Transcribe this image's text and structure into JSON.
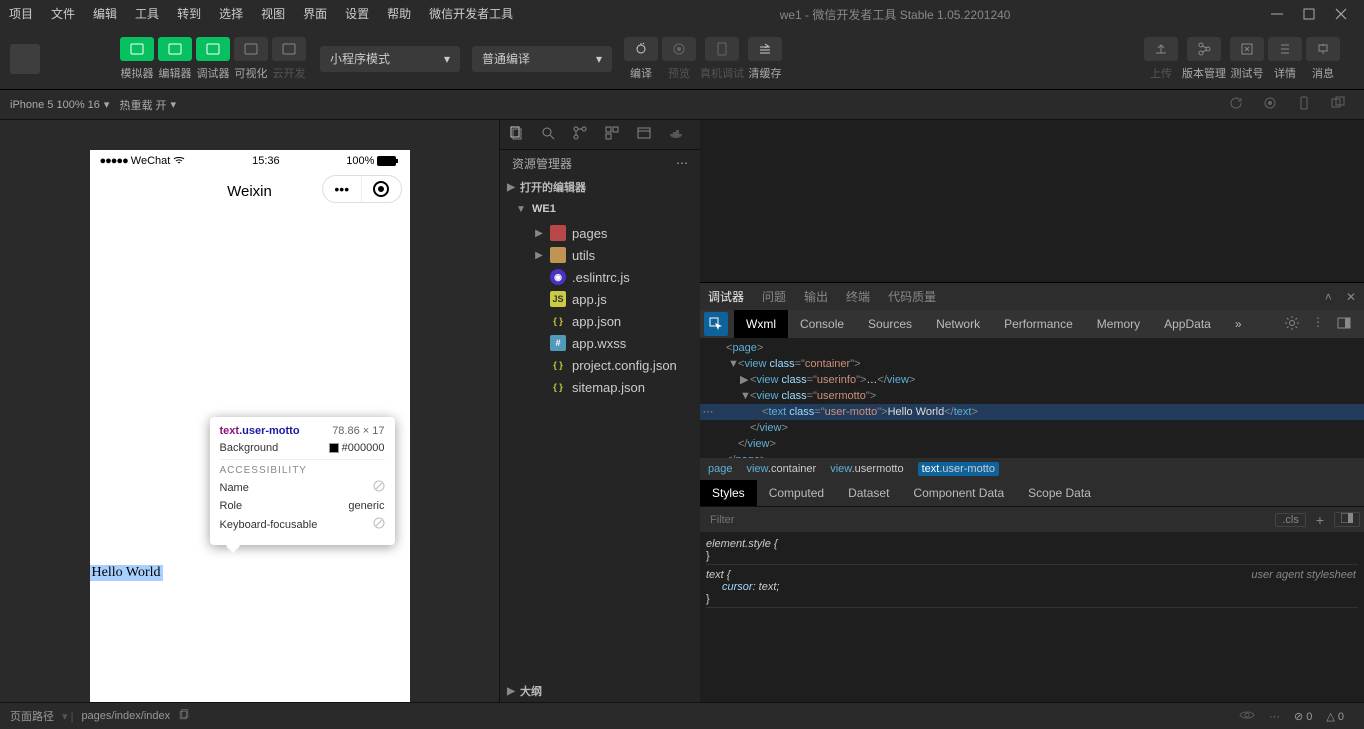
{
  "titlebar": {
    "menus": [
      "项目",
      "文件",
      "编辑",
      "工具",
      "转到",
      "选择",
      "视图",
      "界面",
      "设置",
      "帮助",
      "微信开发者工具"
    ],
    "title": "we1 - 微信开发者工具 Stable 1.05.2201240"
  },
  "toolbar": {
    "items": [
      {
        "label": "模拟器",
        "green": true
      },
      {
        "label": "编辑器",
        "green": true
      },
      {
        "label": "调试器",
        "green": true
      },
      {
        "label": "可视化",
        "green": false
      },
      {
        "label": "云开发",
        "green": false,
        "dim": true
      }
    ],
    "mode_dd": "小程序模式",
    "compile_dd": "普通编译",
    "mid_items": [
      {
        "label": "编译"
      },
      {
        "label": "预览",
        "dim": true
      },
      {
        "label": "真机调试",
        "dim": true
      },
      {
        "label": "清缓存"
      }
    ],
    "right_items": [
      "上传",
      "版本管理",
      "测试号",
      "详情",
      "消息"
    ]
  },
  "simbar": {
    "device": "iPhone 5 100% 16",
    "hot": "热重载 开"
  },
  "phone": {
    "carrier": "WeChat",
    "time": "15:36",
    "battery": "100%",
    "nav_title": "Weixin",
    "hello": "Hello World"
  },
  "inspect": {
    "sel_tag": "text",
    "sel_cls": ".user-motto",
    "dims": "78.86 × 17",
    "bg_label": "Background",
    "bg_val": "#000000",
    "acc": "ACCESSIBILITY",
    "rows": [
      {
        "k": "Name",
        "v": ""
      },
      {
        "k": "Role",
        "v": "generic"
      },
      {
        "k": "Keyboard-focusable",
        "v": ""
      }
    ]
  },
  "explorer": {
    "title": "资源管理器",
    "open_editors": "打开的编辑器",
    "project": "WE1",
    "tree": [
      {
        "name": "pages",
        "ico": "ico-folder-red",
        "folder": true
      },
      {
        "name": "utils",
        "ico": "ico-folder",
        "folder": true
      },
      {
        "name": ".eslintrc.js",
        "ico": "ico-eslint"
      },
      {
        "name": "app.js",
        "ico": "ico-js"
      },
      {
        "name": "app.json",
        "ico": "ico-json"
      },
      {
        "name": "app.wxss",
        "ico": "ico-css"
      },
      {
        "name": "project.config.json",
        "ico": "ico-json"
      },
      {
        "name": "sitemap.json",
        "ico": "ico-json"
      }
    ],
    "outline": "大纲"
  },
  "devtools": {
    "outer_tabs": [
      "调试器",
      "问题",
      "输出",
      "终端",
      "代码质量"
    ],
    "inner_tabs": [
      "Wxml",
      "Console",
      "Sources",
      "Network",
      "Performance",
      "Memory",
      "AppData"
    ],
    "crumbs": [
      {
        "t": "page",
        "c": ""
      },
      {
        "t": "view",
        "c": ".container"
      },
      {
        "t": "view",
        "c": ".usermotto"
      },
      {
        "t": "text",
        "c": ".user-motto",
        "sel": true
      }
    ],
    "style_tabs": [
      "Styles",
      "Computed",
      "Dataset",
      "Component Data",
      "Scope Data"
    ],
    "filter_ph": "Filter",
    "cls_btn": ".cls",
    "el_style": "element.style {",
    "text_rule": "text {",
    "cursor_prop": "cursor",
    "cursor_val": ": text;",
    "ua_sheet": "user agent stylesheet"
  },
  "wxml": [
    {
      "l": 0,
      "ar": "",
      "h": "<span class='wx-punc'>&lt;</span><span class='wx-tag'>page</span><span class='wx-punc'>&gt;</span>"
    },
    {
      "l": 1,
      "ar": "▼",
      "h": "<span class='wx-punc'>&lt;</span><span class='wx-tag'>view</span> <span class='wx-attr'>class</span><span class='wx-punc'>=\"</span><span class='wx-str'>container</span><span class='wx-punc'>\"&gt;</span>"
    },
    {
      "l": 2,
      "ar": "▶",
      "h": "<span class='wx-punc'>&lt;</span><span class='wx-tag'>view</span> <span class='wx-attr'>class</span><span class='wx-punc'>=\"</span><span class='wx-str'>userinfo</span><span class='wx-punc'>\"&gt;</span><span class='wx-txt'>…</span><span class='wx-punc'>&lt;/</span><span class='wx-tag'>view</span><span class='wx-punc'>&gt;</span>"
    },
    {
      "l": 2,
      "ar": "▼",
      "h": "<span class='wx-punc'>&lt;</span><span class='wx-tag'>view</span> <span class='wx-attr'>class</span><span class='wx-punc'>=\"</span><span class='wx-str'>usermotto</span><span class='wx-punc'>\"&gt;</span>"
    },
    {
      "l": 3,
      "ar": "",
      "hl": true,
      "h": "<span class='wx-punc'>&lt;</span><span class='wx-tag'>text</span> <span class='wx-attr'>class</span><span class='wx-punc'>=\"</span><span class='wx-str'>user-motto</span><span class='wx-punc'>\"&gt;</span><span class='wx-txt'>Hello World</span><span class='wx-punc'>&lt;/</span><span class='wx-tag'>text</span><span class='wx-punc'>&gt;</span>"
    },
    {
      "l": 2,
      "ar": "",
      "h": "<span class='wx-punc'>&lt;/</span><span class='wx-tag'>view</span><span class='wx-punc'>&gt;</span>"
    },
    {
      "l": 1,
      "ar": "",
      "h": "<span class='wx-punc'>&lt;/</span><span class='wx-tag'>view</span><span class='wx-punc'>&gt;</span>"
    },
    {
      "l": 0,
      "ar": "",
      "h": "<span class='wx-punc'>&lt;/</span><span class='wx-tag'>page</span><span class='wx-punc'>&gt;</span>"
    }
  ],
  "statusbar": {
    "path_label": "页面路径",
    "path": "pages/index/index",
    "errors": "0",
    "warnings": "0"
  }
}
